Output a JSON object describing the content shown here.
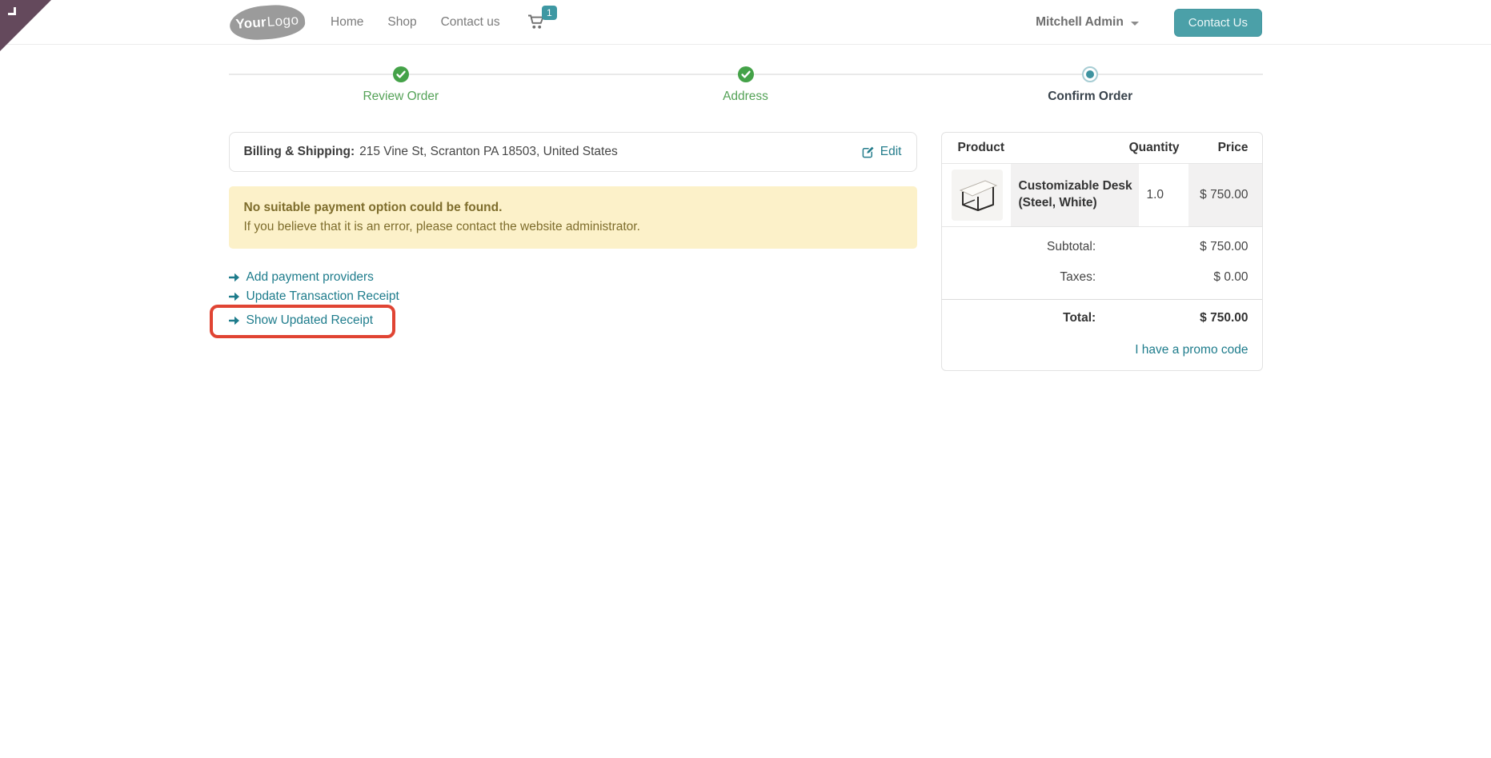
{
  "header": {
    "logo": {
      "part1": "Your",
      "part2": "Logo"
    },
    "nav": [
      {
        "label": "Home"
      },
      {
        "label": "Shop"
      },
      {
        "label": "Contact us"
      }
    ],
    "cart_count": "1",
    "user_menu_label": "Mitchell Admin",
    "contact_button_label": "Contact Us"
  },
  "steps": [
    {
      "label": "Review Order",
      "state": "done"
    },
    {
      "label": "Address",
      "state": "done"
    },
    {
      "label": "Confirm Order",
      "state": "current"
    }
  ],
  "billing": {
    "label": "Billing & Shipping:",
    "address": "215 Vine St, Scranton PA 18503, United States",
    "edit_label": "Edit"
  },
  "warning": {
    "title": "No suitable payment option could be found.",
    "body": "If you believe that it is an error, please contact the website administrator."
  },
  "actions": [
    {
      "label": "Add payment providers",
      "highlighted": false
    },
    {
      "label": "Update Transaction Receipt",
      "highlighted": false
    },
    {
      "label": "Show Updated Receipt",
      "highlighted": true
    }
  ],
  "order_summary": {
    "headers": {
      "product": "Product",
      "quantity": "Quantity",
      "price": "Price"
    },
    "items": [
      {
        "name": "Customizable Desk (Steel, White)",
        "quantity": "1.0",
        "price": "$ 750.00"
      }
    ],
    "subtotal_label": "Subtotal:",
    "subtotal_value": "$ 750.00",
    "taxes_label": "Taxes:",
    "taxes_value": "$ 0.00",
    "total_label": "Total:",
    "total_value": "$ 750.00",
    "promo_link_label": "I have a promo code"
  },
  "colors": {
    "accent_teal": "#4ba0a8",
    "link_teal": "#1e7c8c",
    "success_green": "#44a248",
    "warning_bg": "#fcf1c9",
    "warning_text": "#7e6d2c",
    "highlight_red": "#e04433",
    "ribbon_purple": "#64495c"
  }
}
